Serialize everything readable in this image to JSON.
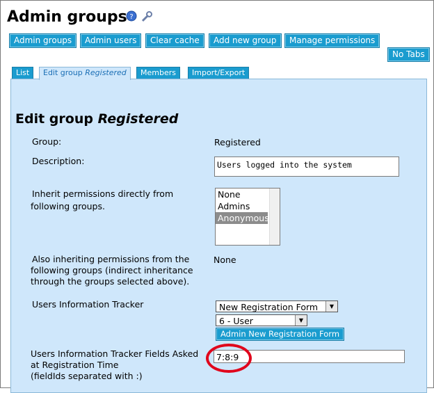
{
  "header": {
    "title": "Admin groups"
  },
  "toolbar": {
    "admin_groups": "Admin groups",
    "admin_users": "Admin users",
    "clear_cache": "Clear cache",
    "add_new_group": "Add new group",
    "manage_permissions": "Manage permissions",
    "no_tabs": "No Tabs"
  },
  "tabs": {
    "list": "List",
    "edit_prefix": "Edit group ",
    "edit_name": "Registered",
    "members": "Members",
    "import_export": "Import/Export"
  },
  "form": {
    "heading_prefix": "Edit group ",
    "heading_name": "Registered",
    "group_label": "Group:",
    "group_value": "Registered",
    "description_label": "Description:",
    "description_value": "Users logged into the system",
    "inherit_label_1": "Inherit permissions directly from",
    "inherit_label_2": "following groups.",
    "inherit_options": [
      "None",
      "Admins",
      "Anonymous"
    ],
    "inherit_selected": "Anonymous",
    "also_label_1": "Also inheriting permissions from the",
    "also_label_2": "following groups (indirect inheritance",
    "also_label_3": "through the groups selected above).",
    "also_value": "None",
    "tracker_label": "Users Information Tracker",
    "tracker_select": "New Registration Form",
    "tracker_item_select": "6 - User",
    "admin_form_button": "Admin New Registration Form",
    "fields_label_1": "Users Information Tracker Fields Asked",
    "fields_label_2": "at Registration Time",
    "fields_label_3": "(fieldIds separated with :)",
    "fields_value": "7:8:9"
  },
  "colors": {
    "button_blue": "#1a9ccf",
    "panel_bg": "#cfe7fb",
    "highlight_circle": "#e0061c"
  }
}
